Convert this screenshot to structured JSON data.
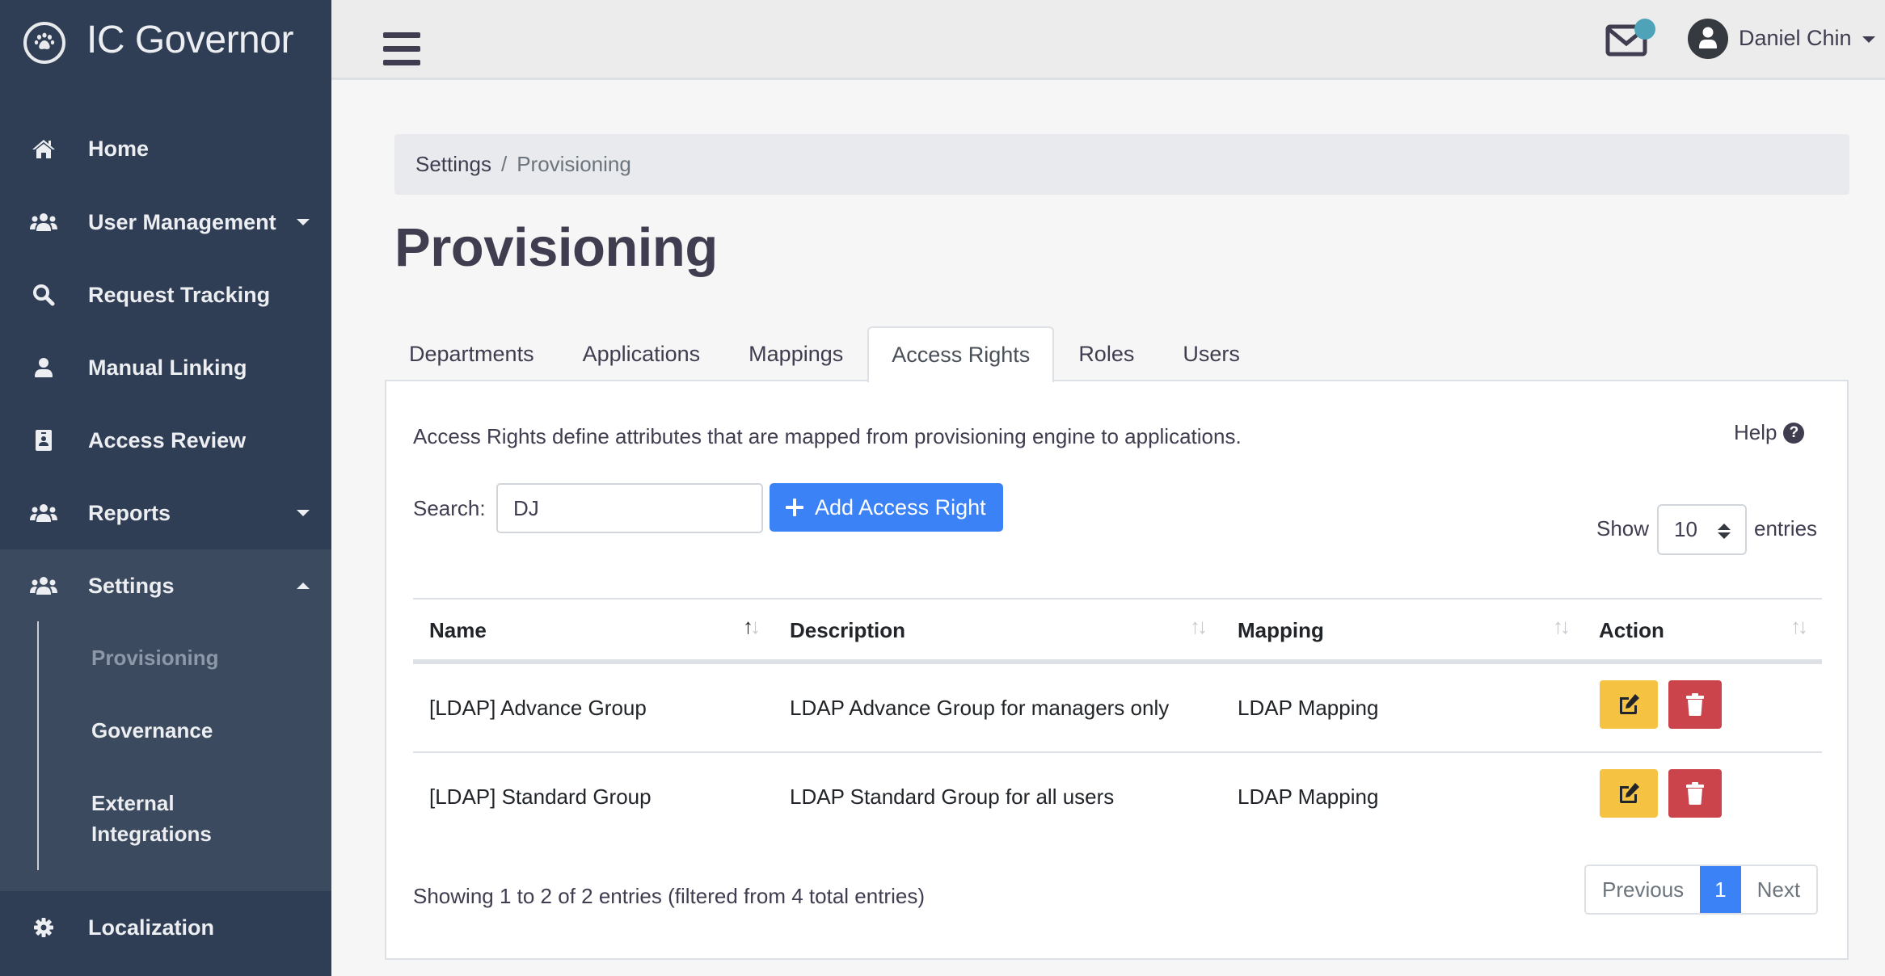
{
  "app": {
    "title": "IC Governor",
    "logo_icon": "paw-icon"
  },
  "sidebar": {
    "items": [
      {
        "label": "Home",
        "icon": "home-icon"
      },
      {
        "label": "User Management",
        "icon": "users-icon",
        "expandable": true,
        "expanded": false
      },
      {
        "label": "Request Tracking",
        "icon": "search-icon"
      },
      {
        "label": "Manual Linking",
        "icon": "user-icon"
      },
      {
        "label": "Access Review",
        "icon": "id-badge-icon"
      },
      {
        "label": "Reports",
        "icon": "users-icon",
        "expandable": true,
        "expanded": false
      },
      {
        "label": "Settings",
        "icon": "users-icon",
        "expandable": true,
        "expanded": true
      },
      {
        "label": "Localization",
        "icon": "gear-icon"
      }
    ],
    "settings_subitems": [
      {
        "label": "Provisioning",
        "active": true
      },
      {
        "label": "Governance",
        "active": false
      },
      {
        "label": "External Integrations",
        "active": false
      }
    ],
    "colors": {
      "background": "#2f3d55",
      "expanded_section": "#3b4a5e"
    }
  },
  "topbar": {
    "menu_icon": "hamburger-icon",
    "mail_icon": "envelope-icon",
    "mail_badge_color": "#4fa3b8",
    "user_name": "Daniel Chin"
  },
  "breadcrumb": [
    {
      "label": "Settings",
      "active": false
    },
    {
      "label": "Provisioning",
      "active": true
    }
  ],
  "breadcrumb_separator": "/",
  "page_title": "Provisioning",
  "tabs": [
    {
      "label": "Departments",
      "active": false
    },
    {
      "label": "Applications",
      "active": false
    },
    {
      "label": "Mappings",
      "active": false
    },
    {
      "label": "Access Rights",
      "active": true
    },
    {
      "label": "Roles",
      "active": false
    },
    {
      "label": "Users",
      "active": false
    }
  ],
  "panel": {
    "description": "Access Rights define attributes that are mapped from provisioning engine to applications.",
    "help_label": "Help",
    "search_label": "Search:",
    "search_value": "DJ",
    "add_button_label": "Add Access Right",
    "show_label": "Show",
    "page_size": "10",
    "entries_label": "entries",
    "accent_color": "#3b82f6"
  },
  "table": {
    "columns": [
      {
        "label": "Name",
        "sort": "asc"
      },
      {
        "label": "Description",
        "sort": "none"
      },
      {
        "label": "Mapping",
        "sort": "none"
      },
      {
        "label": "Action",
        "sort": "none"
      }
    ],
    "rows": [
      {
        "name": "[LDAP] Advance Group",
        "description": "LDAP Advance Group for managers only",
        "mapping": "LDAP Mapping"
      },
      {
        "name": "[LDAP] Standard Group",
        "description": "LDAP Standard Group for all users",
        "mapping": "LDAP Mapping"
      }
    ],
    "edit_color": "#f5c242",
    "delete_color": "#cc444b"
  },
  "footer": {
    "info": "Showing 1 to 2 of 2 entries (filtered from 4 total entries)",
    "pagination": {
      "previous": "Previous",
      "current": "1",
      "next": "Next"
    }
  }
}
